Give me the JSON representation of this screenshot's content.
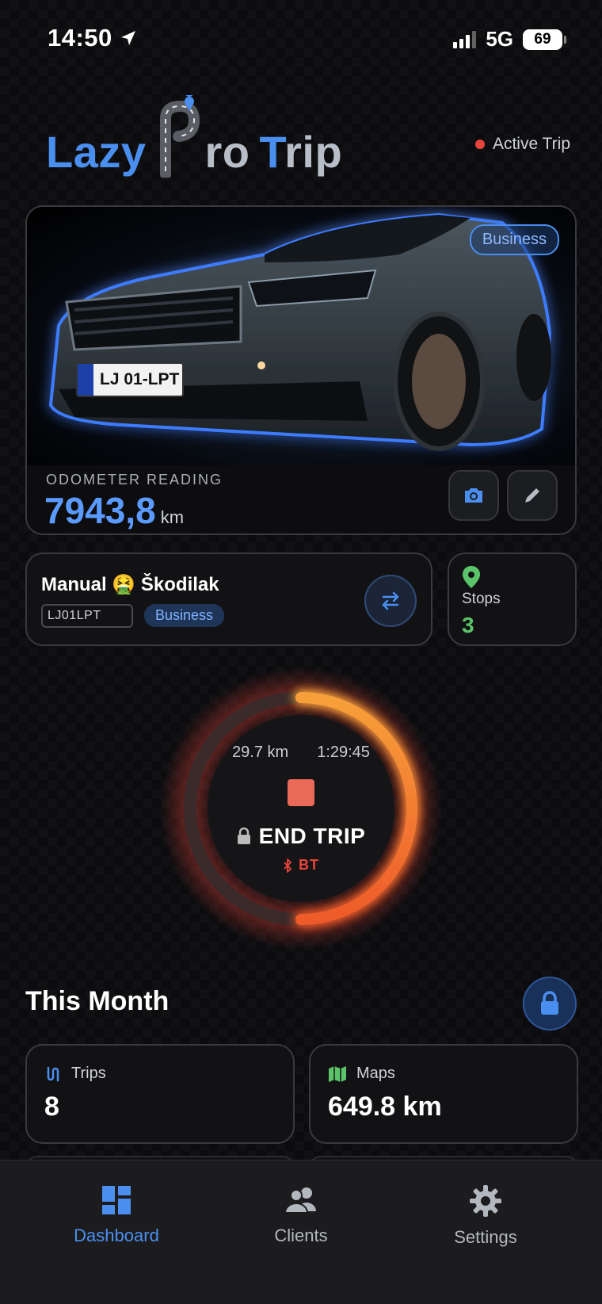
{
  "status_bar": {
    "time": "14:50",
    "network": "5G",
    "battery": "69"
  },
  "header": {
    "logo_lazy": "Lazy",
    "logo_ro": "ro",
    "logo_t": "T",
    "logo_rip": "rip",
    "active_trip": "Active Trip"
  },
  "car_card": {
    "type_badge": "Business",
    "plate_text": "LJ 01-LPT",
    "odometer_label": "ODOMETER READING",
    "odometer_value": "7943,8",
    "odometer_unit": "km"
  },
  "vehicle": {
    "name": "Manual 🤮 Škodilak",
    "plate": "LJ01LPT",
    "category": "Business"
  },
  "stops": {
    "label": "Stops",
    "value": "3"
  },
  "trip": {
    "distance": "29.7 km",
    "duration": "1:29:45",
    "end_label": "END TRIP",
    "connection": "BT",
    "progress": 0.5
  },
  "month": {
    "title": "This Month",
    "trips_label": "Trips",
    "trips_value": "8",
    "maps_label": "Maps",
    "maps_value": "649.8 km"
  },
  "tabs": [
    {
      "label": "Dashboard",
      "icon": "dashboard-icon",
      "active": true
    },
    {
      "label": "Clients",
      "icon": "clients-icon",
      "active": false
    },
    {
      "label": "Settings",
      "icon": "gear-icon",
      "active": false
    }
  ],
  "colors": {
    "accent": "#4a8ff0",
    "danger": "#e8443a",
    "success": "#5bc46a",
    "trip_ring": "#f08a2c"
  }
}
